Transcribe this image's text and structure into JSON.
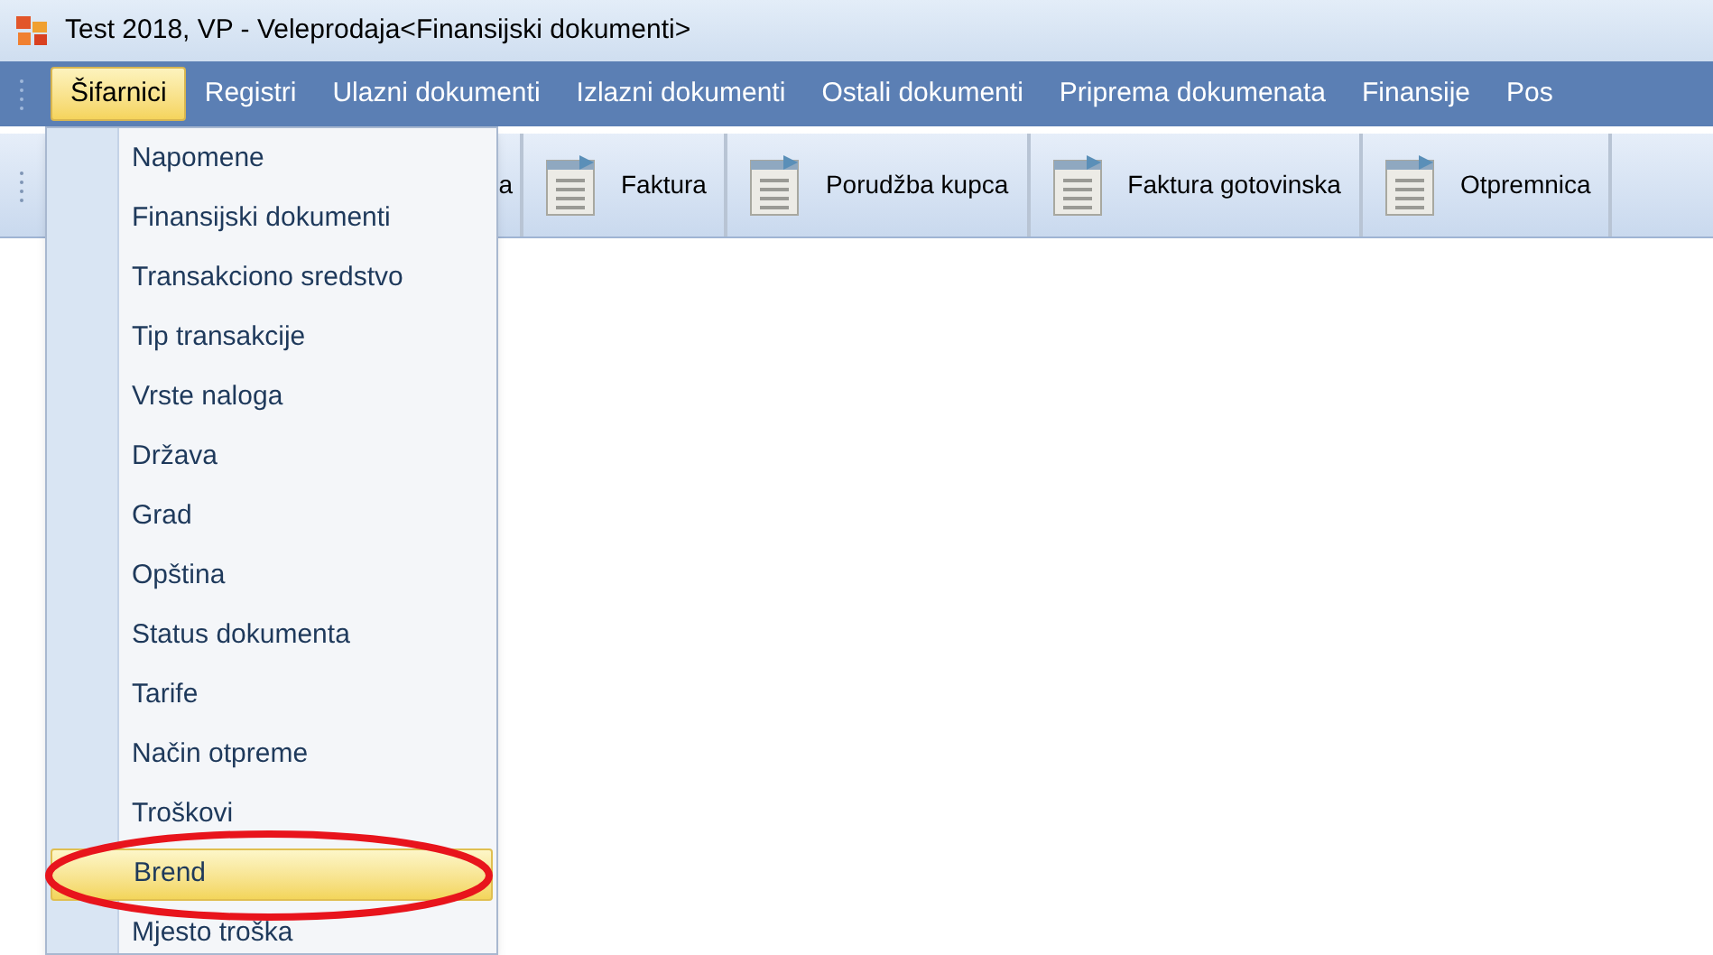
{
  "window": {
    "title": "Test 2018, VP - Veleprodaja<Finansijski dokumenti>"
  },
  "menu_bar": [
    {
      "label": "Šifarnici",
      "selected": true
    },
    {
      "label": "Registri",
      "selected": false
    },
    {
      "label": "Ulazni dokumenti",
      "selected": false
    },
    {
      "label": "Izlazni dokumenti",
      "selected": false
    },
    {
      "label": "Ostali dokumenti",
      "selected": false
    },
    {
      "label": "Priprema dokumenata",
      "selected": false
    },
    {
      "label": "Finansije",
      "selected": false
    },
    {
      "label": "Pos",
      "selected": false
    }
  ],
  "toolbar": [
    {
      "label": "a",
      "icon": false
    },
    {
      "label": "Faktura",
      "icon": true
    },
    {
      "label": "Porudžba kupca",
      "icon": true
    },
    {
      "label": "Faktura gotovinska",
      "icon": true
    },
    {
      "label": "Otpremnica",
      "icon": true
    }
  ],
  "dropdown": [
    {
      "label": "Napomene",
      "selected": false,
      "circled": false
    },
    {
      "label": "Finansijski dokumenti",
      "selected": false,
      "circled": false
    },
    {
      "label": "Transakciono sredstvo",
      "selected": false,
      "circled": false
    },
    {
      "label": "Tip transakcije",
      "selected": false,
      "circled": false
    },
    {
      "label": "Vrste naloga",
      "selected": false,
      "circled": false
    },
    {
      "label": "Država",
      "selected": false,
      "circled": false
    },
    {
      "label": "Grad",
      "selected": false,
      "circled": false
    },
    {
      "label": "Opština",
      "selected": false,
      "circled": false
    },
    {
      "label": "Status dokumenta",
      "selected": false,
      "circled": false
    },
    {
      "label": "Tarife",
      "selected": false,
      "circled": false
    },
    {
      "label": "Način otpreme",
      "selected": false,
      "circled": false
    },
    {
      "label": "Troškovi",
      "selected": false,
      "circled": false
    },
    {
      "label": "Brend",
      "selected": true,
      "circled": true
    },
    {
      "label": "Mjesto troška",
      "selected": false,
      "circled": false
    }
  ]
}
